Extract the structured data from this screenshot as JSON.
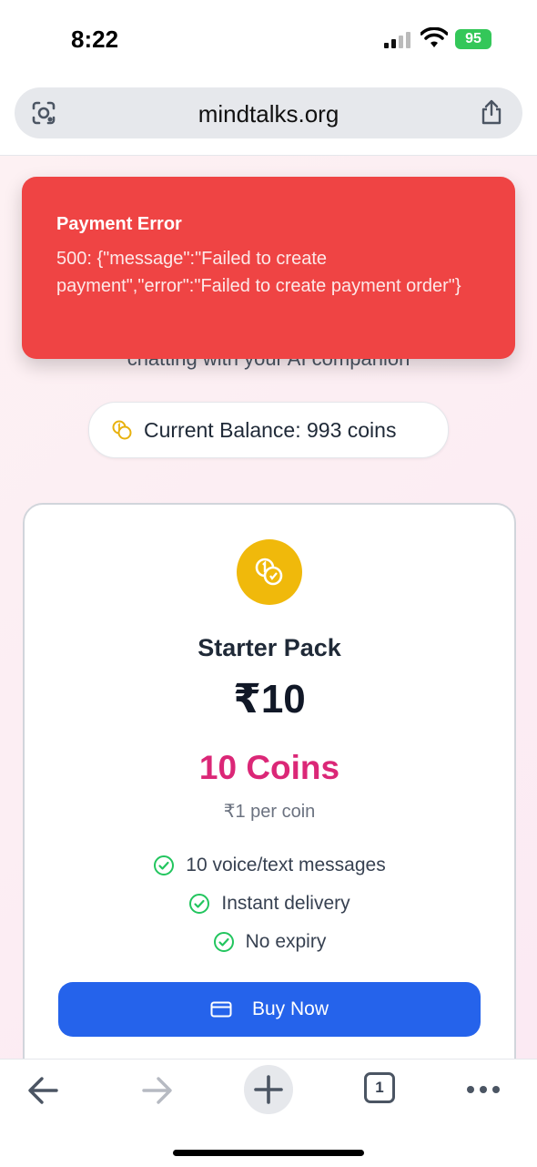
{
  "status_bar": {
    "time": "8:22",
    "battery": "95"
  },
  "browser": {
    "url": "mindtalks.org"
  },
  "page": {
    "subtitle_tail": "chatting with your AI companion",
    "balance": "Current Balance: 993 coins",
    "pack": {
      "name": "Starter Pack",
      "price": "₹10",
      "coins": "10 Coins",
      "per_coin": "₹1 per coin",
      "features": [
        "10 voice/text messages",
        "Instant delivery",
        "No expiry"
      ],
      "buy_label": "Buy Now"
    }
  },
  "error_toast": {
    "title": "Payment Error",
    "message": "500: {\"message\":\"Failed to create payment\",\"error\":\"Failed to create payment order\"}"
  },
  "toolbar": {
    "tab_count": "1"
  },
  "colors": {
    "error_bg": "#ef4444",
    "accent_blue": "#2563eb",
    "accent_pink": "#db2777",
    "coin_gold": "#f0b90b",
    "check_green": "#22c55e"
  }
}
